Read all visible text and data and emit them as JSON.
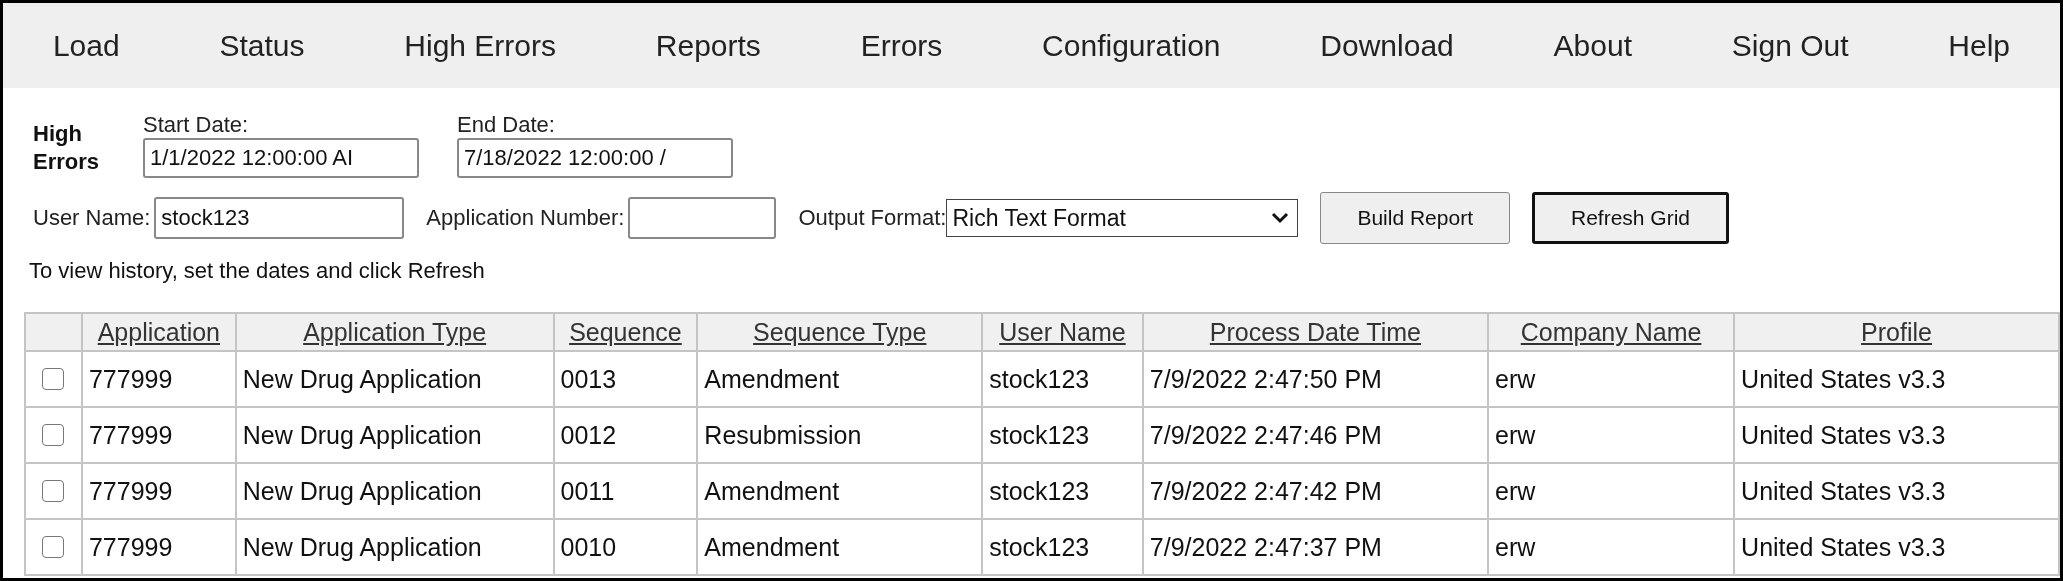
{
  "nav": [
    {
      "label": "Load"
    },
    {
      "label": "Status"
    },
    {
      "label": "High Errors"
    },
    {
      "label": "Reports"
    },
    {
      "label": "Errors"
    },
    {
      "label": "Configuration"
    },
    {
      "label": "Download"
    },
    {
      "label": "About"
    },
    {
      "label": "Sign Out"
    },
    {
      "label": "Help"
    }
  ],
  "form": {
    "title": "High Errors",
    "start_date": {
      "label": "Start Date:",
      "value": "1/1/2022 12:00:00 AI"
    },
    "end_date": {
      "label": "End Date:",
      "value": "7/18/2022 12:00:00 /"
    },
    "user_name": {
      "label": "User Name:",
      "value": "stock123"
    },
    "application_number": {
      "label": "Application Number:"
    },
    "output_format": {
      "label": "Output Format:",
      "value": "Rich Text Format"
    },
    "buttons": [
      {
        "label": "Build Report",
        "focused": false
      },
      {
        "label": "Refresh Grid",
        "focused": true
      }
    ],
    "hint": "To view history, set the dates and click Refresh"
  },
  "table": {
    "columns": [
      "Application",
      "Application Type",
      "Sequence",
      "Sequence Type",
      "User Name",
      "Process Date Time",
      "Company Name",
      "Profile"
    ],
    "rows": [
      {
        "checked": false,
        "cells": [
          "777999",
          "New Drug Application",
          "0013",
          "Amendment",
          "stock123",
          "7/9/2022 2:47:50 PM",
          "erw",
          "United States v3.3"
        ]
      },
      {
        "checked": false,
        "cells": [
          "777999",
          "New Drug Application",
          "0012",
          "Resubmission",
          "stock123",
          "7/9/2022 2:47:46 PM",
          "erw",
          "United States v3.3"
        ]
      },
      {
        "checked": false,
        "cells": [
          "777999",
          "New Drug Application",
          "0011",
          "Amendment",
          "stock123",
          "7/9/2022 2:47:42 PM",
          "erw",
          "United States v3.3"
        ]
      },
      {
        "checked": false,
        "cells": [
          "777999",
          "New Drug Application",
          "0010",
          "Amendment",
          "stock123",
          "7/9/2022 2:47:37 PM",
          "erw",
          "United States v3.3"
        ]
      }
    ]
  }
}
